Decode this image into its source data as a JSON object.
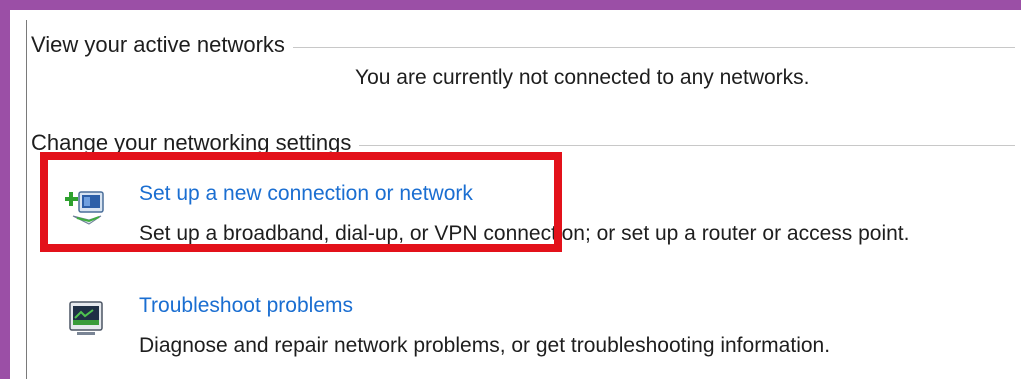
{
  "sections": {
    "active": {
      "title": "View your active networks",
      "status": "You are currently not connected to any networks."
    },
    "change": {
      "title": "Change your networking settings",
      "tasks": [
        {
          "link": "Set up a new connection or network",
          "description": "Set up a broadband, dial-up, or VPN connection; or set up a router or access point.",
          "icon": "new-connection-icon"
        },
        {
          "link": "Troubleshoot problems",
          "description": "Diagnose and repair network problems, or get troubleshooting information.",
          "icon": "troubleshoot-icon"
        }
      ]
    }
  },
  "colors": {
    "link": "#1a6ed1",
    "highlight": "#e3111a",
    "frame": "#9b4fa6"
  }
}
